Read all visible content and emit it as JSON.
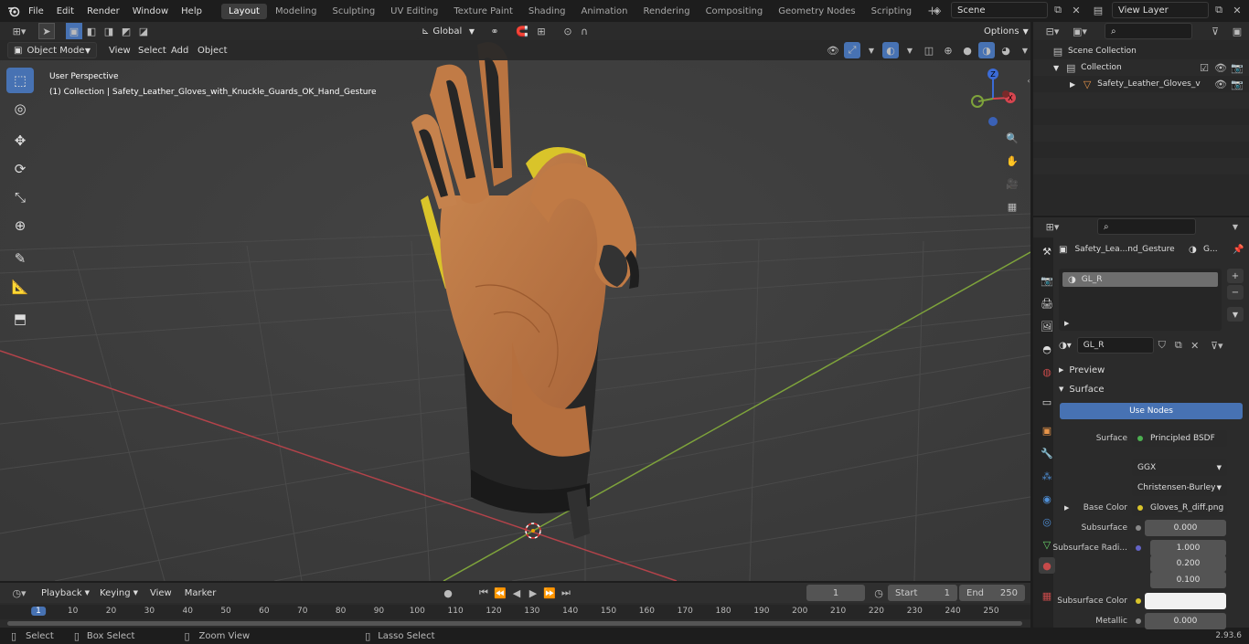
{
  "menu": [
    "File",
    "Edit",
    "Render",
    "Window",
    "Help"
  ],
  "workspaces": [
    "Layout",
    "Modeling",
    "Sculpting",
    "UV Editing",
    "Texture Paint",
    "Shading",
    "Animation",
    "Rendering",
    "Compositing",
    "Geometry Nodes",
    "Scripting"
  ],
  "scene_name": "Scene",
  "view_layer": "View Layer",
  "orientation": "Global",
  "options_label": "Options",
  "viewport": {
    "mode": "Object Mode",
    "menus": [
      "View",
      "Select",
      "Add",
      "Object"
    ],
    "perspective": "User Perspective",
    "collection_info": "(1) Collection | Safety_Leather_Gloves_with_Knuckle_Guards_OK_Hand_Gesture"
  },
  "outliner": {
    "root": "Scene Collection",
    "collection": "Collection",
    "object": "Safety_Leather_Gloves_v"
  },
  "properties": {
    "object_name": "Safety_Lea...nd_Gesture",
    "tab_right": "G...",
    "slot": "GL_R",
    "material": "GL_R",
    "preview": "Preview",
    "surface_section": "Surface",
    "use_nodes": "Use Nodes",
    "surface_label": "Surface",
    "surface_value": "Principled BSDF",
    "distribution": "GGX",
    "subsurface_method": "Christensen-Burley",
    "base_color_label": "Base Color",
    "base_color_value": "Gloves_R_diff.png",
    "subsurface_label": "Subsurface",
    "subsurface_value": "0.000",
    "subsurface_radius_label": "Subsurface Radi...",
    "radius": [
      "1.000",
      "0.200",
      "0.100"
    ],
    "subsurface_color_label": "Subsurface Color",
    "metallic_label": "Metallic",
    "metallic_value": "0.000"
  },
  "timeline": {
    "menus": [
      "Playback",
      "Keying",
      "View",
      "Marker"
    ],
    "current_frame": "1",
    "start_label": "Start",
    "start": "1",
    "end_label": "End",
    "end": "250",
    "ticks": [
      "1",
      "10",
      "20",
      "30",
      "40",
      "50",
      "60",
      "70",
      "80",
      "90",
      "100",
      "110",
      "120",
      "130",
      "140",
      "150",
      "160",
      "170",
      "180",
      "190",
      "200",
      "210",
      "220",
      "230",
      "240",
      "250"
    ]
  },
  "status": {
    "select": "Select",
    "box_select": "Box Select",
    "zoom_view": "Zoom View",
    "lasso_select": "Lasso Select",
    "version": "2.93.6"
  },
  "colors": {
    "accent": "#4772b3",
    "x_axis": "#b3434a",
    "y_axis": "#7ea33b",
    "glove_tan": "#c07a45",
    "glove_dark": "#262626",
    "guard_yellow": "#d9c42a"
  }
}
